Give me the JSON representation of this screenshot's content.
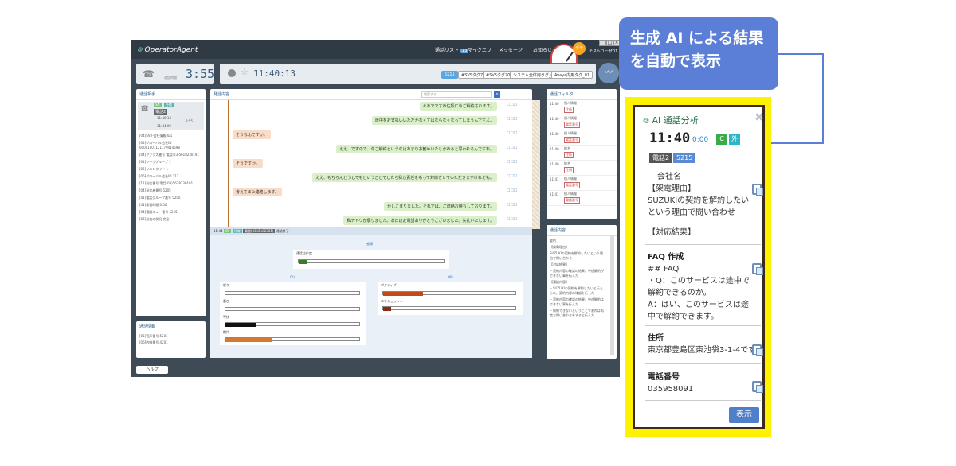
{
  "app": {
    "logo": "OperatorAgent",
    "nav": [
      "通話リスト",
      "マイクエリ",
      "メッセージ",
      "お知らせ"
    ],
    "nav_badge": "13",
    "user_avatar": "デモ",
    "user_name": "テストユーザ01",
    "talk_label": "通話時間",
    "talk_time": "3:55",
    "clock": "11:40:13",
    "tags": [
      "5215",
      "#SVSタグ701",
      "#SVSタグ704",
      "システム全体用タグ_05",
      "Avaya内用タグ_01"
    ],
    "left_panel_title": "通話相手",
    "left_badges": [
      "SN",
      "外線"
    ],
    "left_call_tag": "電話2",
    "left_times": [
      "11:40:13",
      "3:55",
      "11:44:09"
    ],
    "left_fields": [
      "[04]SVR-会社情報 0/1",
      "[04]グローバル会社ID 00001001121179414598",
      "[04]ファクス番号 電話(03)5618230191",
      "[04]ワークグループ 1",
      "[05]ジエンタイド 1",
      "[06]グローバル会社ID 112",
      "[11]発信番号 電話(03)5618230191",
      "[04]発信者番号 5205",
      "[41]電話グループ番号 5200",
      "[41]保留時間 0:00",
      "[04]通話キュー番号 5215",
      "[06]発信の状況 完全"
    ],
    "left_info_title": "通話情報",
    "left_info_fields": [
      "[05]音声番号 5201",
      "[06]内線番号 4201"
    ],
    "chat_title": "発話内容",
    "chat_search_placeholder": "検索する",
    "messages": [
      {
        "side": "r",
        "text": "それでですね住所に今ご解約されます。"
      },
      {
        "side": "r",
        "text": "途中をお支払いいただかなくてはならなくなってしまうんですよ。"
      },
      {
        "side": "l",
        "text": "そうなんですか。"
      },
      {
        "side": "r",
        "text": "ええ、ですので、今ご解約というのはあまりお勧めいたしかねると思われるんですね。"
      },
      {
        "side": "l",
        "text": "そうですか。"
      },
      {
        "side": "r",
        "text": "ええ、もちろんどうしてもということでしたら私が責任をもって対応させていただきますけれども。"
      },
      {
        "side": "l",
        "text": "考えてまた連絡します。"
      },
      {
        "side": "r",
        "text": "かしこまりました。それでは、ご連絡お待ちしております。"
      },
      {
        "side": "r",
        "text": "私ナトウが承りました。本日はお電話ありがとうございました。失礼いたします。"
      }
    ],
    "analysis_header": [
      "11:44",
      "SN",
      "外線",
      "電話(0356182301)",
      "通話終了"
    ],
    "emotion_title": "感情",
    "emotion_overall": "通話全体度",
    "axis_cu": "CU",
    "axis_op": "OP",
    "emotions_left": [
      "怒り",
      "喜び",
      "不快",
      "期待"
    ],
    "emotions_right": [
      "ポジティブ",
      "エナジェッシュ"
    ],
    "filter_title": "通話フィルタ",
    "filters": [
      {
        "time": "11:40",
        "a": "個人情報",
        "b": "住所"
      },
      {
        "time": "11:40",
        "a": "個人情報",
        "b": "電話番号"
      },
      {
        "time": "11:40",
        "a": "個人情報",
        "b": "電話番号"
      },
      {
        "time": "11:40",
        "a": "地名",
        "b": "住所"
      },
      {
        "time": "11:40",
        "a": "地名",
        "b": "住所"
      },
      {
        "time": "11:41",
        "a": "個人情報",
        "b": "電話番号"
      },
      {
        "time": "11:41",
        "a": "個人情報",
        "b": "電話番号"
      }
    ],
    "memo_title": "通話内容",
    "memo_text": [
      "要約",
      "【架電理由】",
      "SUZUKIの契約を解約したいという理由で問い合わせ",
      "【対応結果】",
      "・契約内容の確認の結果、中途解約ができない事を伝えた",
      "【通話内容】",
      "・SUZUKIの契約を解約したいと伝えられ、契約内容の確認を行った",
      "・契約内容の確認の結果、中途解約はできない事を伝えた",
      "・解約できないということであれば再度お問い合わせをすると伝えた"
    ],
    "bottom_tab": "ヘルプ"
  },
  "callout": {
    "text_line1": "生成 AI による結果",
    "text_line2": "を自動で表示"
  },
  "ai": {
    "title": "AI 通話分析",
    "time": "11:40",
    "time_sec": "0:00",
    "badge_a": "C",
    "badge_b": "外",
    "tag1": "電話2",
    "tag2": "5215",
    "company": "会社名",
    "reason_head": "【架電理由】",
    "reason_body": "SUZUKIの契約を解約したいという理由で問い合わせ",
    "result_head": "【対応結果】",
    "faq_title": "FAQ 作成",
    "faq_line1": "## FAQ",
    "faq_line2": "・Q：このサービスは途中で解約できるのか。",
    "faq_line3": "A：はい、このサービスは途中で解約できます。",
    "address_title": "住所",
    "address_value": "東京都豊島区東池袋3-1-4です",
    "phone_title": "電話番号",
    "phone_value": "035958091",
    "show_button": "表示"
  },
  "colors": {
    "accent": "#5b7fd6",
    "highlight": "#fff200",
    "panel_dark": "#3e4a56"
  }
}
